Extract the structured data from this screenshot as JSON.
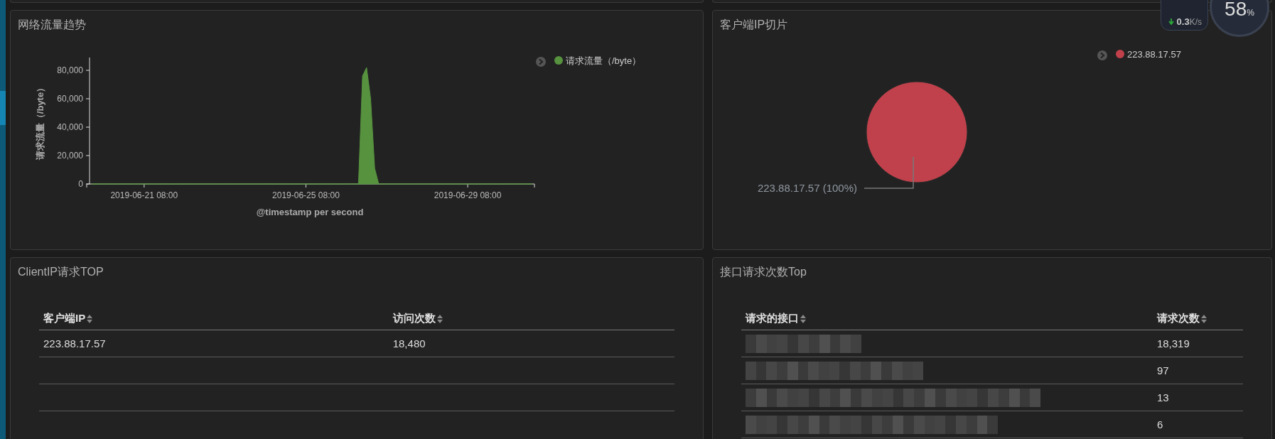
{
  "speed_widget": {
    "download_speed": "0.3",
    "unit": "K/s",
    "percent": "58",
    "percent_sign": "%"
  },
  "traffic_panel": {
    "title": "网络流量趋势",
    "chart_data": {
      "type": "area",
      "xlabel": "@timestamp per second",
      "ylabel": "请求流量（/byte）",
      "categories": [
        null,
        null,
        null,
        null,
        null,
        null,
        null,
        null,
        null,
        null,
        null,
        null,
        null,
        "2019-06-21 08:00",
        null,
        null,
        null,
        null,
        null,
        null,
        null,
        null,
        null,
        null,
        null,
        null,
        null,
        null,
        null,
        null,
        null,
        null,
        null,
        null,
        null,
        null,
        null,
        null,
        null,
        null,
        null,
        null,
        null,
        null,
        null,
        null,
        null,
        null,
        null,
        null,
        null,
        null,
        null,
        "2019-06-25 08:00",
        null,
        null,
        null,
        null,
        null,
        null,
        null,
        null,
        null,
        null,
        null,
        null,
        null,
        null,
        null,
        null,
        null,
        null,
        null,
        null,
        null,
        null,
        null,
        null,
        null,
        null,
        null,
        null,
        null,
        null,
        null,
        null,
        null,
        null,
        null,
        null,
        null,
        null,
        null,
        "2019-06-29 08:00",
        null,
        null,
        null,
        null,
        null,
        null,
        null,
        null,
        null,
        null,
        null,
        null,
        null,
        null,
        null,
        null
      ],
      "series": [
        {
          "name": "请求流量（/byte）",
          "color": "#57923f",
          "values": [
            0,
            0,
            0,
            0,
            0,
            0,
            0,
            0,
            0,
            0,
            0,
            0,
            0,
            0,
            0,
            0,
            0,
            0,
            0,
            0,
            0,
            0,
            0,
            0,
            0,
            0,
            0,
            0,
            0,
            0,
            0,
            0,
            0,
            0,
            0,
            0,
            0,
            0,
            0,
            0,
            0,
            0,
            0,
            0,
            0,
            0,
            0,
            0,
            0,
            0,
            0,
            0,
            0,
            0,
            0,
            0,
            0,
            0,
            0,
            0,
            0,
            0,
            0,
            0,
            0,
            0,
            0,
            76000,
            82000,
            60000,
            11000,
            0,
            0,
            0,
            0,
            0,
            0,
            0,
            0,
            0,
            0,
            0,
            0,
            0,
            0,
            0,
            0,
            0,
            0,
            0,
            0,
            0,
            0,
            0,
            0,
            0,
            0,
            0,
            0,
            0,
            0,
            0,
            0,
            0,
            0,
            0,
            0,
            0,
            0,
            0
          ]
        }
      ],
      "ylim": [
        0,
        89000
      ],
      "yticks": [
        {
          "value": 0,
          "label": "0"
        },
        {
          "value": 20000,
          "label": "20,000"
        },
        {
          "value": 40000,
          "label": "40,000"
        },
        {
          "value": 60000,
          "label": "60,000"
        },
        {
          "value": 80000,
          "label": "80,000"
        }
      ]
    }
  },
  "ip_pie_panel": {
    "title": "客户端IP切片",
    "slices": [
      {
        "label": "223.88.17.57",
        "color": "#c0414b",
        "caption": "223.88.17.57 (100%)"
      }
    ]
  },
  "client_ip_table": {
    "title": "ClientIP请求TOP",
    "columns": [
      "客户端IP",
      "访问次数"
    ],
    "rows": [
      {
        "kind": "data",
        "cells": [
          "223.88.17.57",
          "18,480"
        ]
      },
      {
        "kind": "empty"
      },
      {
        "kind": "empty"
      }
    ]
  },
  "endpoint_table": {
    "title": "接口请求次数Top",
    "columns": [
      "请求的接口",
      "请求次数"
    ],
    "rows": [
      {
        "kind": "redacted",
        "count": "18,319"
      },
      {
        "kind": "redacted",
        "count": "97"
      },
      {
        "kind": "redacted",
        "count": "13"
      },
      {
        "kind": "redacted",
        "count": "6"
      }
    ]
  }
}
